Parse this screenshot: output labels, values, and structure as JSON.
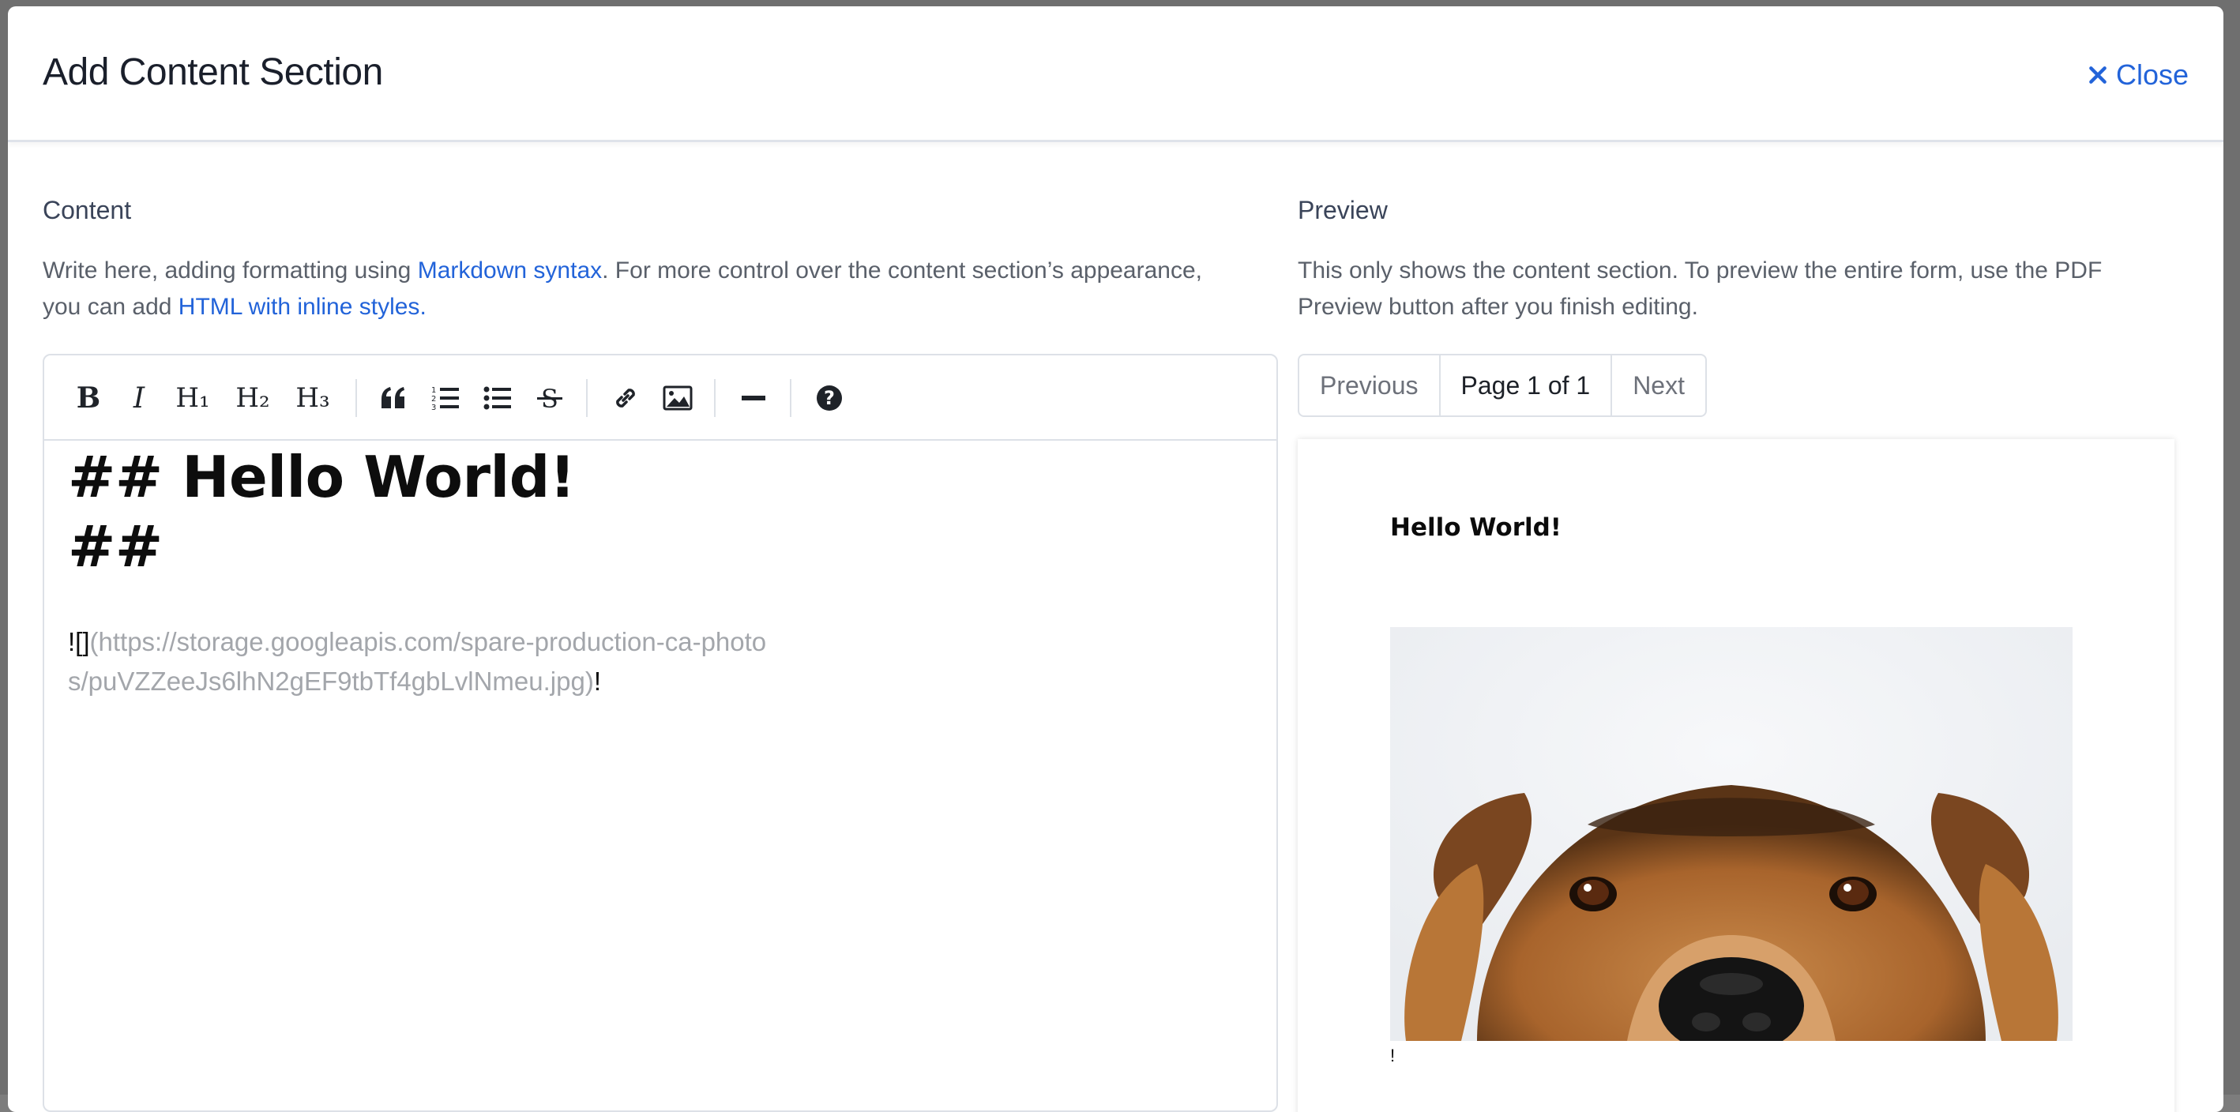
{
  "modal": {
    "title": "Add Content Section",
    "close_label": "Close"
  },
  "content": {
    "label": "Content",
    "help_pre": "Write here, adding formatting using ",
    "help_link1": "Markdown syntax",
    "help_mid": ". For more control over the content section’s appearance, you can add ",
    "help_link2": "HTML with inline styles",
    "help_end": ".",
    "toolbar": {
      "bold": "B",
      "italic": "I",
      "h1": "H₁",
      "h2": "H₂",
      "h3": "H₃",
      "icons": [
        "bold-icon",
        "italic-icon",
        "heading-1-icon",
        "heading-2-icon",
        "heading-3-icon",
        "quote-icon",
        "ordered-list-icon",
        "unordered-list-icon",
        "strikethrough-icon",
        "link-icon",
        "image-icon",
        "horizontal-rule-icon",
        "help-icon"
      ]
    },
    "editor": {
      "line1": "## Hello World!",
      "line2": "##",
      "img_prefix": "![]",
      "img_url": "(https://storage.googleapis.com/spare-production-ca-photos/puVZZeeJs6lhN2gEF9tbTf4gbLvlNmeu.jpg)",
      "img_suffix": "!"
    }
  },
  "preview": {
    "label": "Preview",
    "help": "This only shows the content section. To preview the entire form, use the PDF Preview button after you finish editing.",
    "pager": {
      "previous": "Previous",
      "current": "Page 1 of 1",
      "next": "Next"
    },
    "page": {
      "heading": "Hello World!",
      "image_alt": "dog-photo",
      "trailing": "!"
    }
  },
  "colors": {
    "accent": "#2263d9",
    "text": "#1a1f2b",
    "muted": "#5a606a",
    "border": "#dde1e7"
  }
}
